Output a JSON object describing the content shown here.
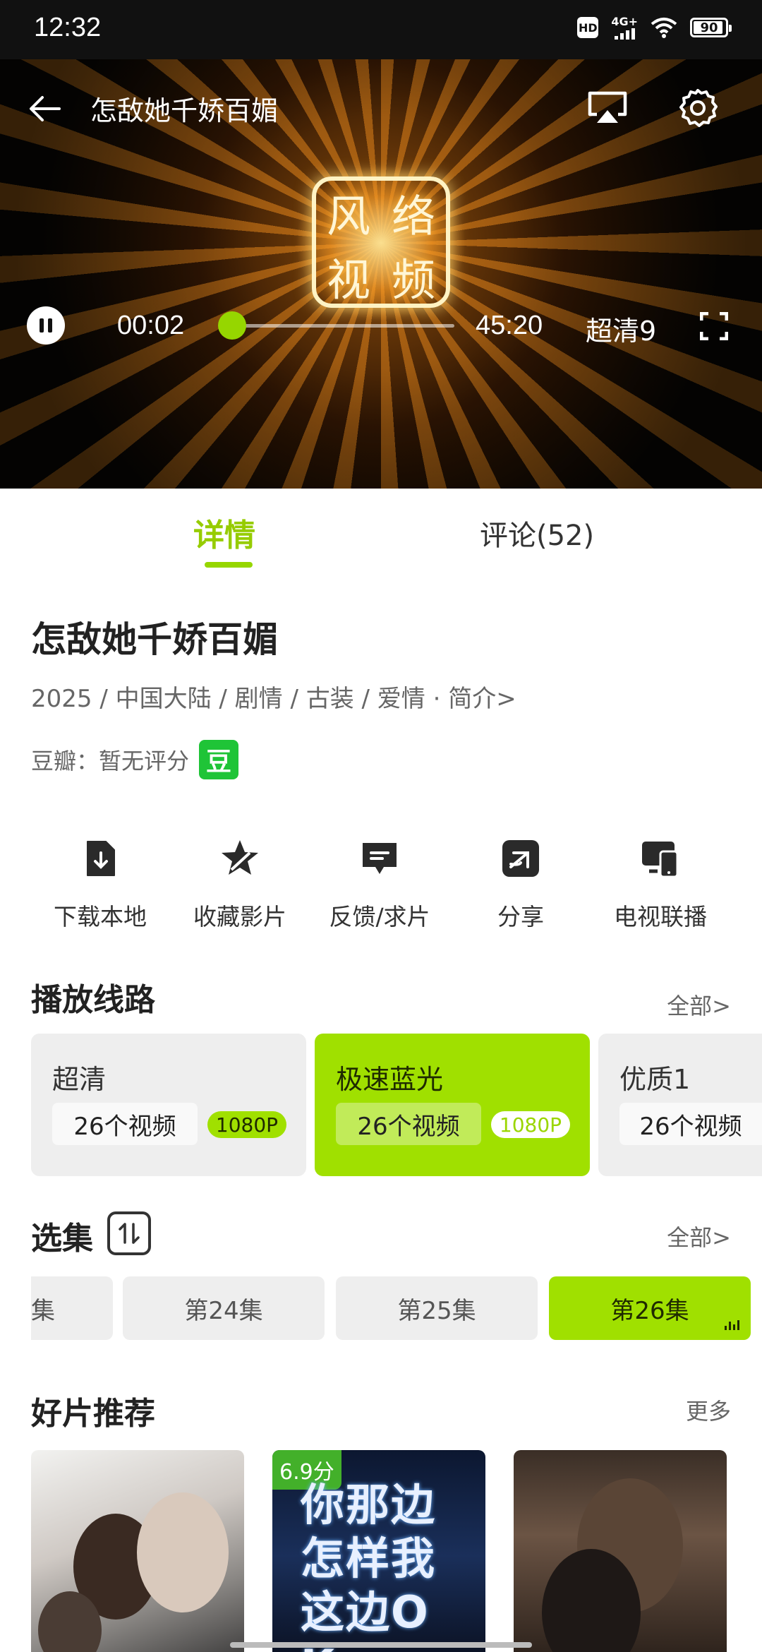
{
  "status_bar": {
    "time": "12:32",
    "network": "4G+",
    "battery": "90",
    "hd_label": "HD"
  },
  "player": {
    "title": "怎敌她千娇百媚",
    "current_time": "00:02",
    "total_time": "45:20",
    "quality": "超清9",
    "progress": 0.004,
    "logo_chars": [
      "风",
      "络",
      "视",
      "频"
    ]
  },
  "tabs": [
    {
      "label": "详情",
      "active": true
    },
    {
      "label": "评论(52)",
      "active": false
    }
  ],
  "detail": {
    "title": "怎敌她千娇百媚",
    "meta": "2025 / 中国大陆 / 剧情 / 古装 / 爱情 · 简介>",
    "douban_label": "豆瓣：暂无评分",
    "douban_badge": "豆"
  },
  "actions": [
    {
      "label": "下载本地",
      "icon": "download-file-icon"
    },
    {
      "label": "收藏影片",
      "icon": "star-icon"
    },
    {
      "label": "反馈/求片",
      "icon": "chat-bubble-icon"
    },
    {
      "label": "分享",
      "icon": "share-icon"
    },
    {
      "label": "电视联播",
      "icon": "tv-cast-icon"
    }
  ],
  "lines_section": {
    "title": "播放线路",
    "more": "全部>",
    "items": [
      {
        "name": "超清",
        "count": "26个视频",
        "res": "1080P",
        "active": false
      },
      {
        "name": "极速蓝光",
        "count": "26个视频",
        "res": "1080P",
        "active": true
      },
      {
        "name": "优质1",
        "count": "26个视频",
        "res": "",
        "active": false
      }
    ]
  },
  "episodes_section": {
    "title": "选集",
    "more": "全部>",
    "items": [
      {
        "label": "集",
        "active": false
      },
      {
        "label": "第24集",
        "active": false
      },
      {
        "label": "第25集",
        "active": false
      },
      {
        "label": "第26集",
        "active": true
      }
    ]
  },
  "recommend_section": {
    "title": "好片推荐",
    "more": "更多",
    "posters": [
      {
        "score": ""
      },
      {
        "score": "6.9分",
        "text": "你那边怎样我这边OK"
      },
      {
        "score": ""
      }
    ]
  },
  "colors": {
    "accent": "#a0e000",
    "tab_active": "#96cc00",
    "douban": "#1fc437"
  }
}
